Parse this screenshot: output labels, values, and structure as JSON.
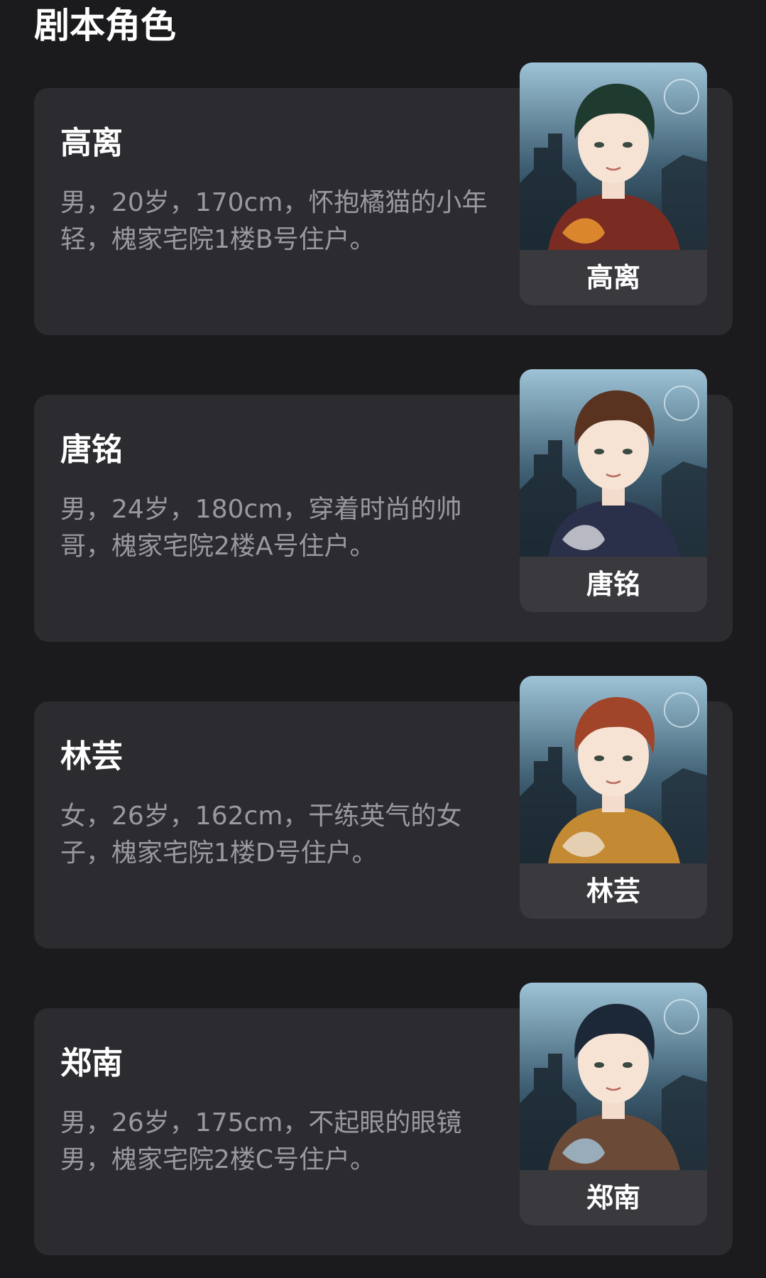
{
  "section": {
    "title": "剧本角色"
  },
  "roles": [
    {
      "name": "高离",
      "description": "男，20岁，170cm，怀抱橘猫的小年轻，槐家宅院1楼B号住户。",
      "portrait_label": "高离",
      "hair_color": "#1f3a2e",
      "outfit_color": "#7a2b22",
      "accent_color": "#e3902f"
    },
    {
      "name": "唐铭",
      "description": "男，24岁，180cm，穿着时尚的帅哥，槐家宅院2楼A号住户。",
      "portrait_label": "唐铭",
      "hair_color": "#5a3220",
      "outfit_color": "#2a2f4a",
      "accent_color": "#c9c9d2"
    },
    {
      "name": "林芸",
      "description": "女，26岁，162cm，干练英气的女子，槐家宅院1楼D号住户。",
      "portrait_label": "林芸",
      "hair_color": "#a0442a",
      "outfit_color": "#c48a33",
      "accent_color": "#e8d6c0"
    },
    {
      "name": "郑南",
      "description": "男，26岁，175cm，不起眼的眼镜男，槐家宅院2楼C号住户。",
      "portrait_label": "郑南",
      "hair_color": "#1c2838",
      "outfit_color": "#6b4a38",
      "accent_color": "#9fb7c8"
    }
  ]
}
